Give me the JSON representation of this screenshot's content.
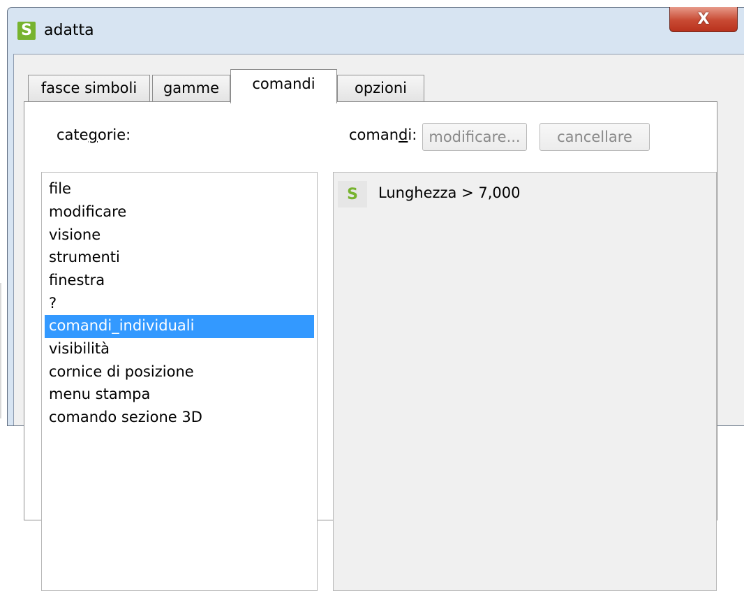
{
  "window": {
    "title": "adatta",
    "close_symbol": "X"
  },
  "tabs": [
    {
      "label": "fasce simboli",
      "active": false
    },
    {
      "label": "gamme",
      "active": false
    },
    {
      "label": "comandi",
      "active": true
    },
    {
      "label": "opzioni",
      "active": false
    }
  ],
  "categories": {
    "label_pre": "cate",
    "label_ul": "g",
    "label_post": "orie:",
    "items": [
      "file",
      "modificare",
      "visione",
      "strumenti",
      "finestra",
      "?",
      "comandi_individuali",
      "visibilità",
      "cornice di posizione",
      "menu stampa",
      "comando sezione 3D"
    ],
    "selected": "comandi_individuali"
  },
  "commands": {
    "label_pre": "coman",
    "label_ul": "d",
    "label_post": "i:",
    "modify_label": "modificare...",
    "delete_label": "cancellare",
    "items": [
      {
        "icon": "s-logo-icon",
        "label": "Lunghezza > 7,000"
      }
    ]
  },
  "colors": {
    "accent_green": "#77b32f",
    "selection_blue": "#3399ff",
    "close_red": "#c84a33"
  }
}
